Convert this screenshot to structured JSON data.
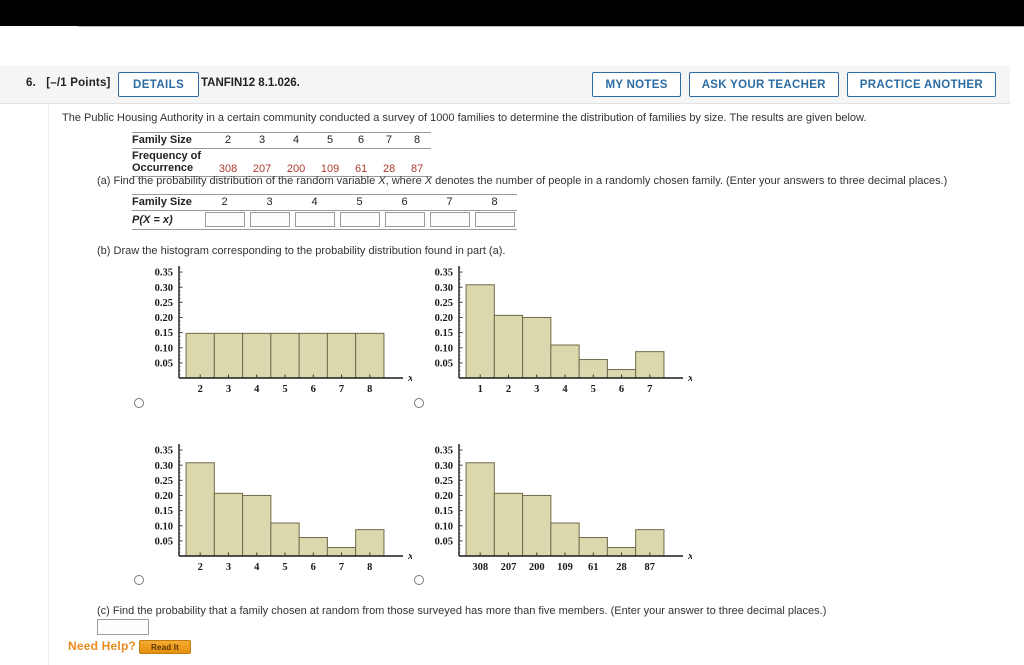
{
  "header": {
    "question_number": "6.",
    "points": "[–/1 Points]",
    "details_label": "DETAILS",
    "question_code": "TANFIN12 8.1.026.",
    "buttons": [
      {
        "label": "MY NOTES"
      },
      {
        "label": "ASK YOUR TEACHER"
      },
      {
        "label": "PRACTICE ANOTHER"
      }
    ]
  },
  "body": {
    "intro": "The Public Housing Authority in a certain community conducted a survey of 1000 families to determine the distribution of families by size. The results are given below.",
    "survey_table": {
      "row1_label": "Family Size",
      "row2_label_line1": "Frequency of",
      "row2_label_line2": "Occurrence",
      "sizes": [
        "2",
        "3",
        "4",
        "5",
        "6",
        "7",
        "8"
      ],
      "frequencies": [
        "308",
        "207",
        "200",
        "109",
        "61",
        "28",
        "87"
      ],
      "frequency_color": "#b03a2e"
    },
    "part_a": {
      "text_before": "(a) Find the probability distribution of the random variable ",
      "text_mid": ", where ",
      "text_after": " denotes the number of people in a randomly chosen family. (Enter your answers to three decimal places.)",
      "var": "X",
      "table": {
        "row1_label": "Family Size",
        "row2_label": "P(X = x)",
        "sizes": [
          "2",
          "3",
          "4",
          "5",
          "6",
          "7",
          "8"
        ],
        "values": [
          "",
          "",
          "",
          "",
          "",
          "",
          ""
        ]
      }
    },
    "part_b": {
      "text": "(b) Draw the histogram corresponding to the probability distribution found in part (a)."
    },
    "part_c": {
      "text": "(c) Find the probability that a family chosen at random from those surveyed has more than five members. (Enter your answer to three decimal places.)",
      "answer": ""
    },
    "need_help": {
      "label": "Need Help?",
      "button_label": "Read It"
    }
  },
  "chart_data": [
    {
      "id": "option-a",
      "type": "bar",
      "title": "",
      "xlabel": "x",
      "ylabel": "",
      "categories": [
        "2",
        "3",
        "4",
        "5",
        "6",
        "7",
        "8"
      ],
      "values": [
        0.1475,
        0.1475,
        0.1475,
        0.1475,
        0.1475,
        0.1475,
        0.1475
      ],
      "yticks": [
        0.05,
        0.1,
        0.15,
        0.2,
        0.25,
        0.3,
        0.35
      ],
      "ytick_labels": [
        "0.05",
        "0.10",
        "0.15",
        "0.20",
        "0.25",
        "0.30",
        "0.35"
      ],
      "ylim": [
        0,
        0.37
      ],
      "grid": false,
      "selected": false,
      "bar_fill": "#dcd8ae",
      "bar_stroke": "#6f6a4b"
    },
    {
      "id": "option-b",
      "type": "bar",
      "title": "",
      "xlabel": "x",
      "ylabel": "",
      "categories": [
        "1",
        "2",
        "3",
        "4",
        "5",
        "6",
        "7"
      ],
      "values": [
        0.308,
        0.207,
        0.2,
        0.109,
        0.061,
        0.028,
        0.087
      ],
      "yticks": [
        0.05,
        0.1,
        0.15,
        0.2,
        0.25,
        0.3,
        0.35
      ],
      "ytick_labels": [
        "0.05",
        "0.10",
        "0.15",
        "0.20",
        "0.25",
        "0.30",
        "0.35"
      ],
      "ylim": [
        0,
        0.37
      ],
      "grid": false,
      "selected": false,
      "bar_fill": "#dcd8ae",
      "bar_stroke": "#6f6a4b"
    },
    {
      "id": "option-c",
      "type": "bar",
      "title": "",
      "xlabel": "x",
      "ylabel": "",
      "categories": [
        "2",
        "3",
        "4",
        "5",
        "6",
        "7",
        "8"
      ],
      "values": [
        0.308,
        0.207,
        0.2,
        0.109,
        0.061,
        0.028,
        0.087
      ],
      "yticks": [
        0.05,
        0.1,
        0.15,
        0.2,
        0.25,
        0.3,
        0.35
      ],
      "ytick_labels": [
        "0.05",
        "0.10",
        "0.15",
        "0.20",
        "0.25",
        "0.30",
        "0.35"
      ],
      "ylim": [
        0,
        0.37
      ],
      "grid": false,
      "selected": false,
      "bar_fill": "#dcd8ae",
      "bar_stroke": "#6f6a4b"
    },
    {
      "id": "option-d",
      "type": "bar",
      "title": "",
      "xlabel": "x",
      "ylabel": "",
      "categories": [
        "308",
        "207",
        "200",
        "109",
        "61",
        "28",
        "87"
      ],
      "values": [
        0.308,
        0.207,
        0.2,
        0.109,
        0.061,
        0.028,
        0.087
      ],
      "yticks": [
        0.05,
        0.1,
        0.15,
        0.2,
        0.25,
        0.3,
        0.35
      ],
      "ytick_labels": [
        "0.05",
        "0.10",
        "0.15",
        "0.20",
        "0.25",
        "0.30",
        "0.35"
      ],
      "ylim": [
        0,
        0.37
      ],
      "grid": false,
      "selected": false,
      "bar_fill": "#dcd8ae",
      "bar_stroke": "#6f6a4b"
    }
  ]
}
